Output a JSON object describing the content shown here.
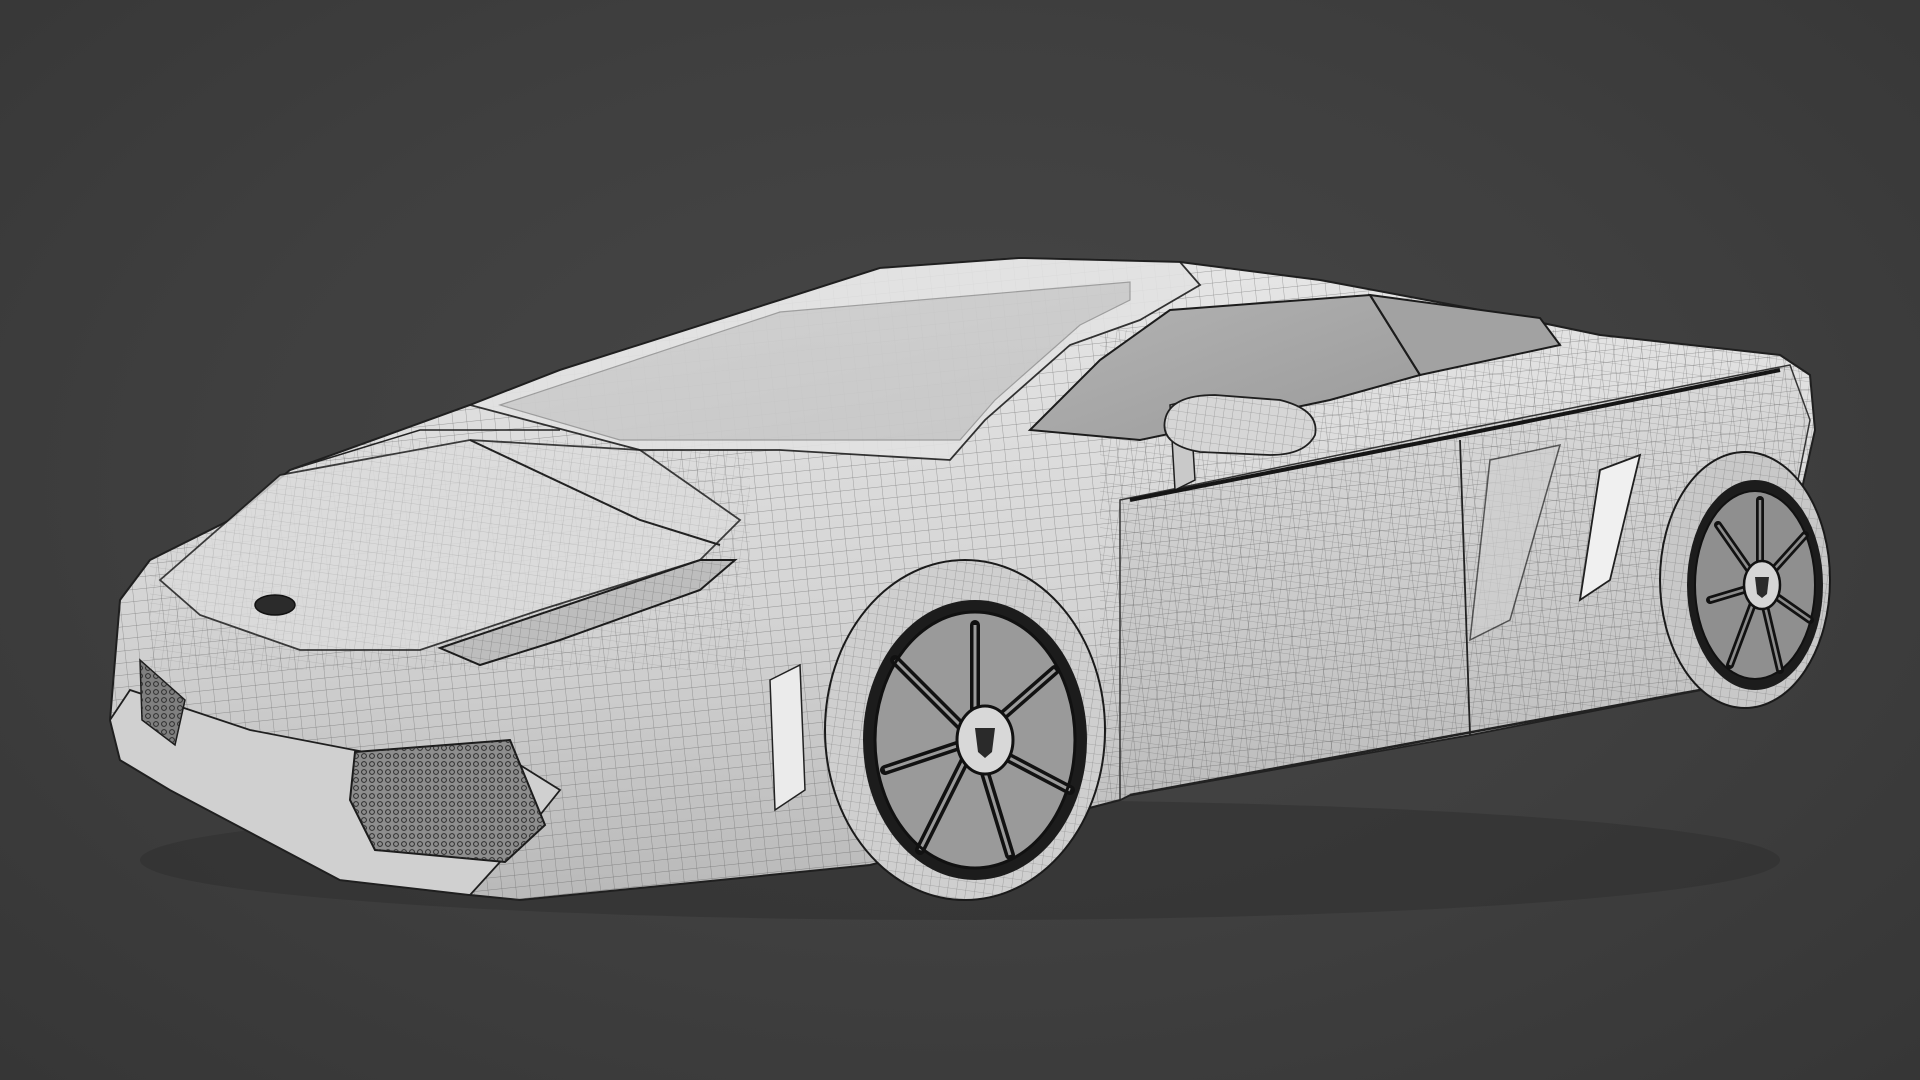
{
  "viewport": {
    "background_color": "#3d3d3d",
    "subject": "sports-car-wireframe-model",
    "render_mode": "solid-with-wireframe-overlay",
    "body_color": "#d9d9d9",
    "shadow_color": "#9c9c9c",
    "glass_color": "#a9a9a9",
    "wire_color": "#2a2a2a",
    "tire_color": "#1c1c1c"
  }
}
